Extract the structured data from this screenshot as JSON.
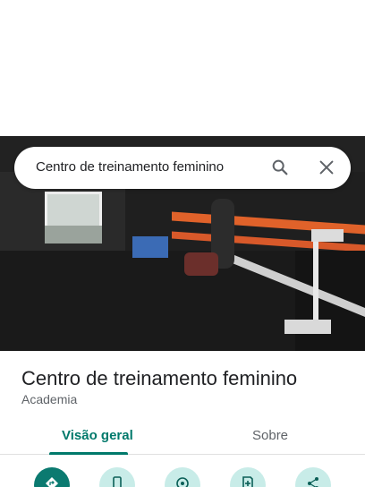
{
  "search": {
    "query": "Centro de treinamento feminino"
  },
  "place": {
    "title": "Centro de treinamento feminino",
    "category": "Academia"
  },
  "tabs": [
    {
      "label": "Visão geral"
    },
    {
      "label": "Sobre"
    }
  ],
  "actions": [
    {
      "icon": "directions-icon"
    },
    {
      "icon": "phone-icon"
    },
    {
      "icon": "location-icon"
    },
    {
      "icon": "save-icon"
    },
    {
      "icon": "share-icon"
    }
  ],
  "colors": {
    "accent": "#00796b",
    "action_primary": "#0b7a70",
    "action_secondary": "#c8ece8"
  }
}
